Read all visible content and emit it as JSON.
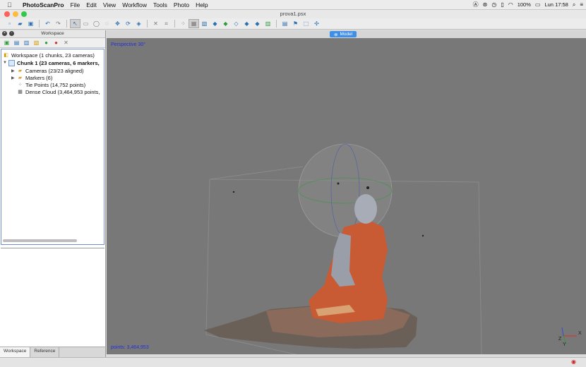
{
  "menubar": {
    "app": "PhotoScanPro",
    "items": [
      "File",
      "Edit",
      "View",
      "Workflow",
      "Tools",
      "Photo",
      "Help"
    ],
    "battery": "100%",
    "clock": "Lun 17:58"
  },
  "window": {
    "title": "prova1.psx"
  },
  "workspace": {
    "panel_title": "Workspace",
    "root": "Workspace (1 chunks, 23 cameras)",
    "chunk": "Chunk 1 (23 cameras, 6 markers,",
    "items": [
      "Cameras (23/23 aligned)",
      "Markers (6)",
      "Tie Points (14,752 points)",
      "Dense Cloud (3,464,953 points,"
    ],
    "tabs": [
      "Workspace",
      "Reference"
    ]
  },
  "model": {
    "tab": "Model",
    "projection": "Perspective 30°",
    "points": "points: 3,464,953",
    "axes": {
      "x": "X",
      "y": "Y",
      "z": "Z"
    }
  },
  "colors": {
    "accent": "#3f8fe6",
    "viewport_bg": "#787878",
    "label_blue": "#2430d8"
  }
}
